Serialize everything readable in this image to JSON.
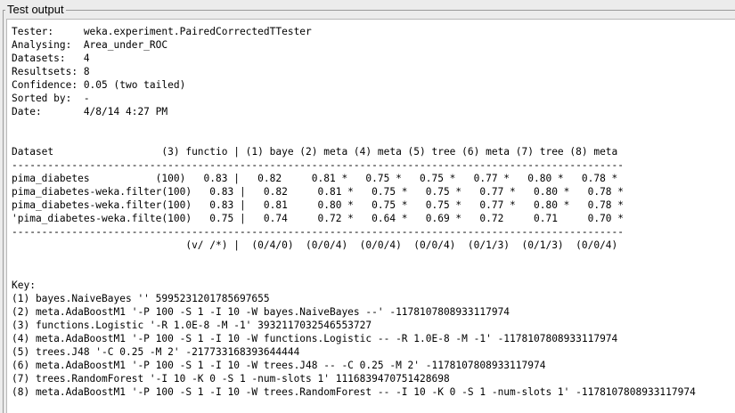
{
  "panel": {
    "title": "Test output"
  },
  "output": {
    "lines": [
      "Tester:     weka.experiment.PairedCorrectedTTester",
      "Analysing:  Area_under_ROC",
      "Datasets:   4",
      "Resultsets: 8",
      "Confidence: 0.05 (two tailed)",
      "Sorted by:  -",
      "Date:       4/8/14 4:27 PM",
      "",
      "",
      "Dataset                  (3) functio | (1) baye (2) meta (4) meta (5) tree (6) meta (7) tree (8) meta",
      "------------------------------------------------------------------------------------------------------",
      "pima_diabetes           (100)   0.83 |   0.82     0.81 *   0.75 *   0.75 *   0.77 *   0.80 *   0.78 *",
      "pima_diabetes-weka.filter(100)   0.83 |   0.82     0.81 *   0.75 *   0.75 *   0.77 *   0.80 *   0.78 *",
      "pima_diabetes-weka.filter(100)   0.83 |   0.81     0.80 *   0.75 *   0.75 *   0.77 *   0.80 *   0.78 *",
      "'pima_diabetes-weka.filte(100)   0.75 |   0.74     0.72 *   0.64 *   0.69 *   0.72     0.71     0.70 *",
      "------------------------------------------------------------------------------------------------------",
      "                             (v/ /*) |  (0/4/0)  (0/0/4)  (0/0/4)  (0/0/4)  (0/1/3)  (0/1/3)  (0/0/4)",
      "",
      "",
      "Key:",
      "(1) bayes.NaiveBayes '' 5995231201785697655",
      "(2) meta.AdaBoostM1 '-P 100 -S 1 -I 10 -W bayes.NaiveBayes --' -1178107808933117974",
      "(3) functions.Logistic '-R 1.0E-8 -M -1' 3932117032546553727",
      "(4) meta.AdaBoostM1 '-P 100 -S 1 -I 10 -W functions.Logistic -- -R 1.0E-8 -M -1' -1178107808933117974",
      "(5) trees.J48 '-C 0.25 -M 2' -217733168393644444",
      "(6) meta.AdaBoostM1 '-P 100 -S 1 -I 10 -W trees.J48 -- -C 0.25 -M 2' -1178107808933117974",
      "(7) trees.RandomForest '-I 10 -K 0 -S 1 -num-slots 1' 1116839470751428698",
      "(8) meta.AdaBoostM1 '-P 100 -S 1 -I 10 -W trees.RandomForest -- -I 10 -K 0 -S 1 -num-slots 1' -1178107808933117974"
    ]
  }
}
